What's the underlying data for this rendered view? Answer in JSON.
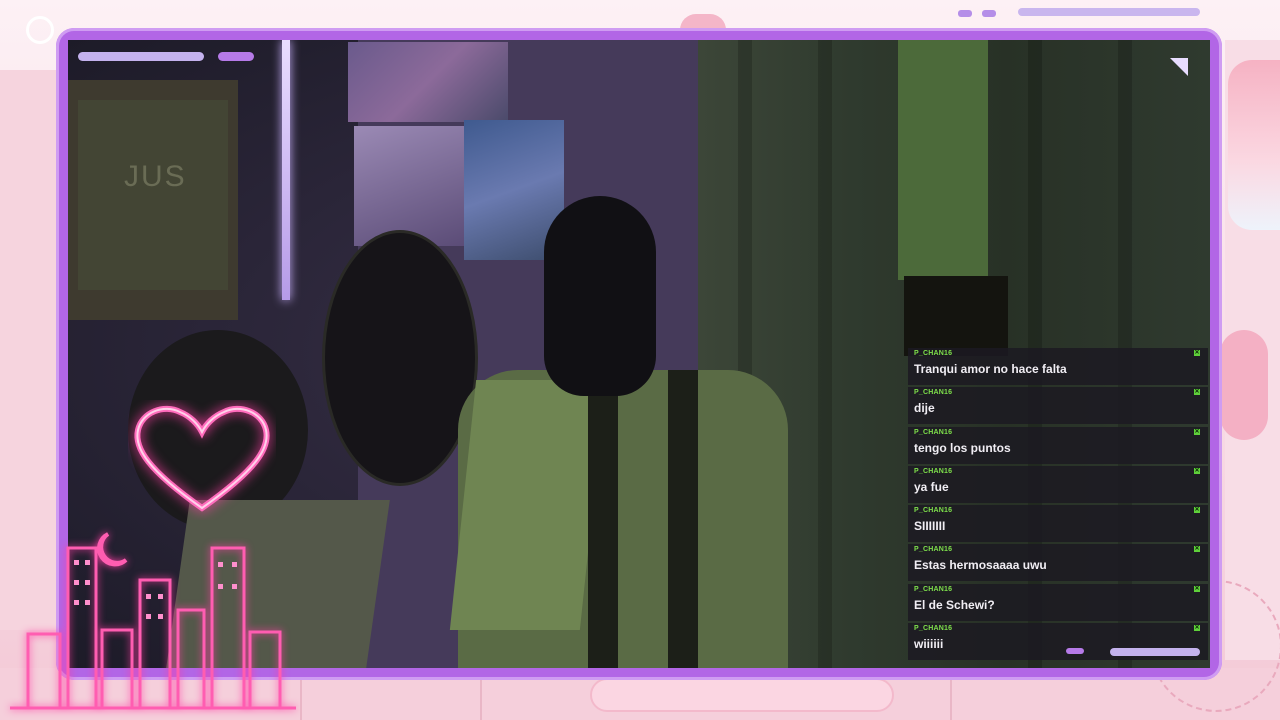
{
  "colors": {
    "frame": "#b266e6",
    "chat_bg": "#1c1a22",
    "username": "#7ee04b",
    "neon_pink": "#ff5db1"
  },
  "overlay": {
    "heart_icon": "neon-heart",
    "moon_icon": "neon-crescent-moon",
    "city_icon": "neon-city-skyline",
    "poster_text": "JUS"
  },
  "chat": {
    "messages": [
      {
        "user": "P_CHAN16",
        "text": "Tranqui amor no hace falta"
      },
      {
        "user": "P_CHAN16",
        "text": "dije"
      },
      {
        "user": "P_CHAN16",
        "text": "tengo los puntos"
      },
      {
        "user": "P_CHAN16",
        "text": "ya fue"
      },
      {
        "user": "P_CHAN16",
        "text": "SIIIIIII"
      },
      {
        "user": "P_CHAN16",
        "text": "Estas hermosaaaa uwu"
      },
      {
        "user": "P_CHAN16",
        "text": "El de Schewi?"
      },
      {
        "user": "P_CHAN16",
        "text": "wiiiiii"
      }
    ],
    "badge_icon": "chat-badge-icon"
  }
}
